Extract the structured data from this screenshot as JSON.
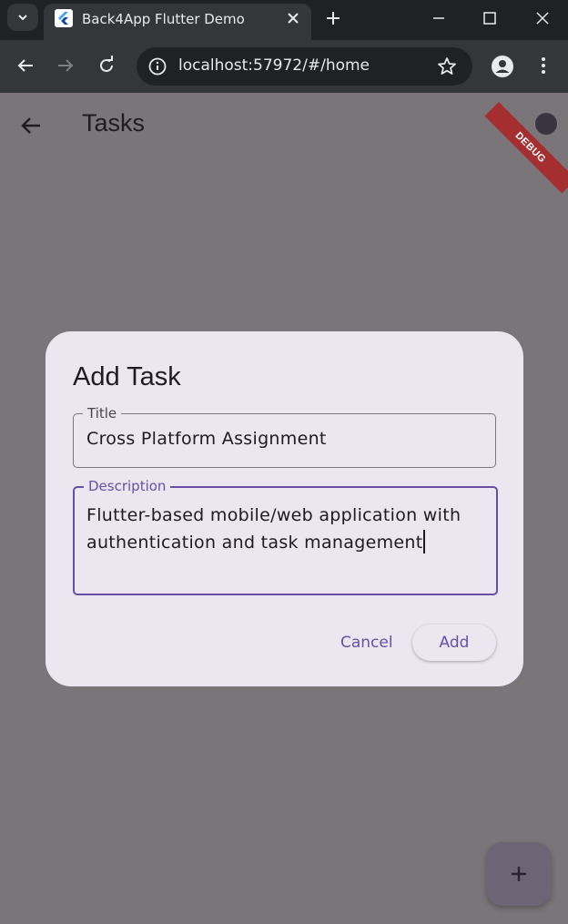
{
  "browser": {
    "tab_title": "Back4App Flutter Demo",
    "url": "localhost:57972/#/home"
  },
  "app": {
    "title": "Tasks",
    "debug_banner": "DEBUG",
    "accent": "#6750a4"
  },
  "dialog": {
    "title": "Add Task",
    "title_field": {
      "label": "Title",
      "value": "Cross Platform Assignment"
    },
    "description_field": {
      "label": "Description",
      "value": "Flutter-based mobile/web application with authentication and task management"
    },
    "cancel_label": "Cancel",
    "add_label": "Add"
  },
  "icons": [
    "tab-search-icon",
    "flutter-favicon-icon",
    "close-icon",
    "plus-icon",
    "minimize-icon",
    "maximize-icon",
    "back-arrow-icon",
    "forward-arrow-icon",
    "reload-icon",
    "info-icon",
    "star-icon",
    "profile-icon",
    "more-vert-icon",
    "add-icon"
  ]
}
